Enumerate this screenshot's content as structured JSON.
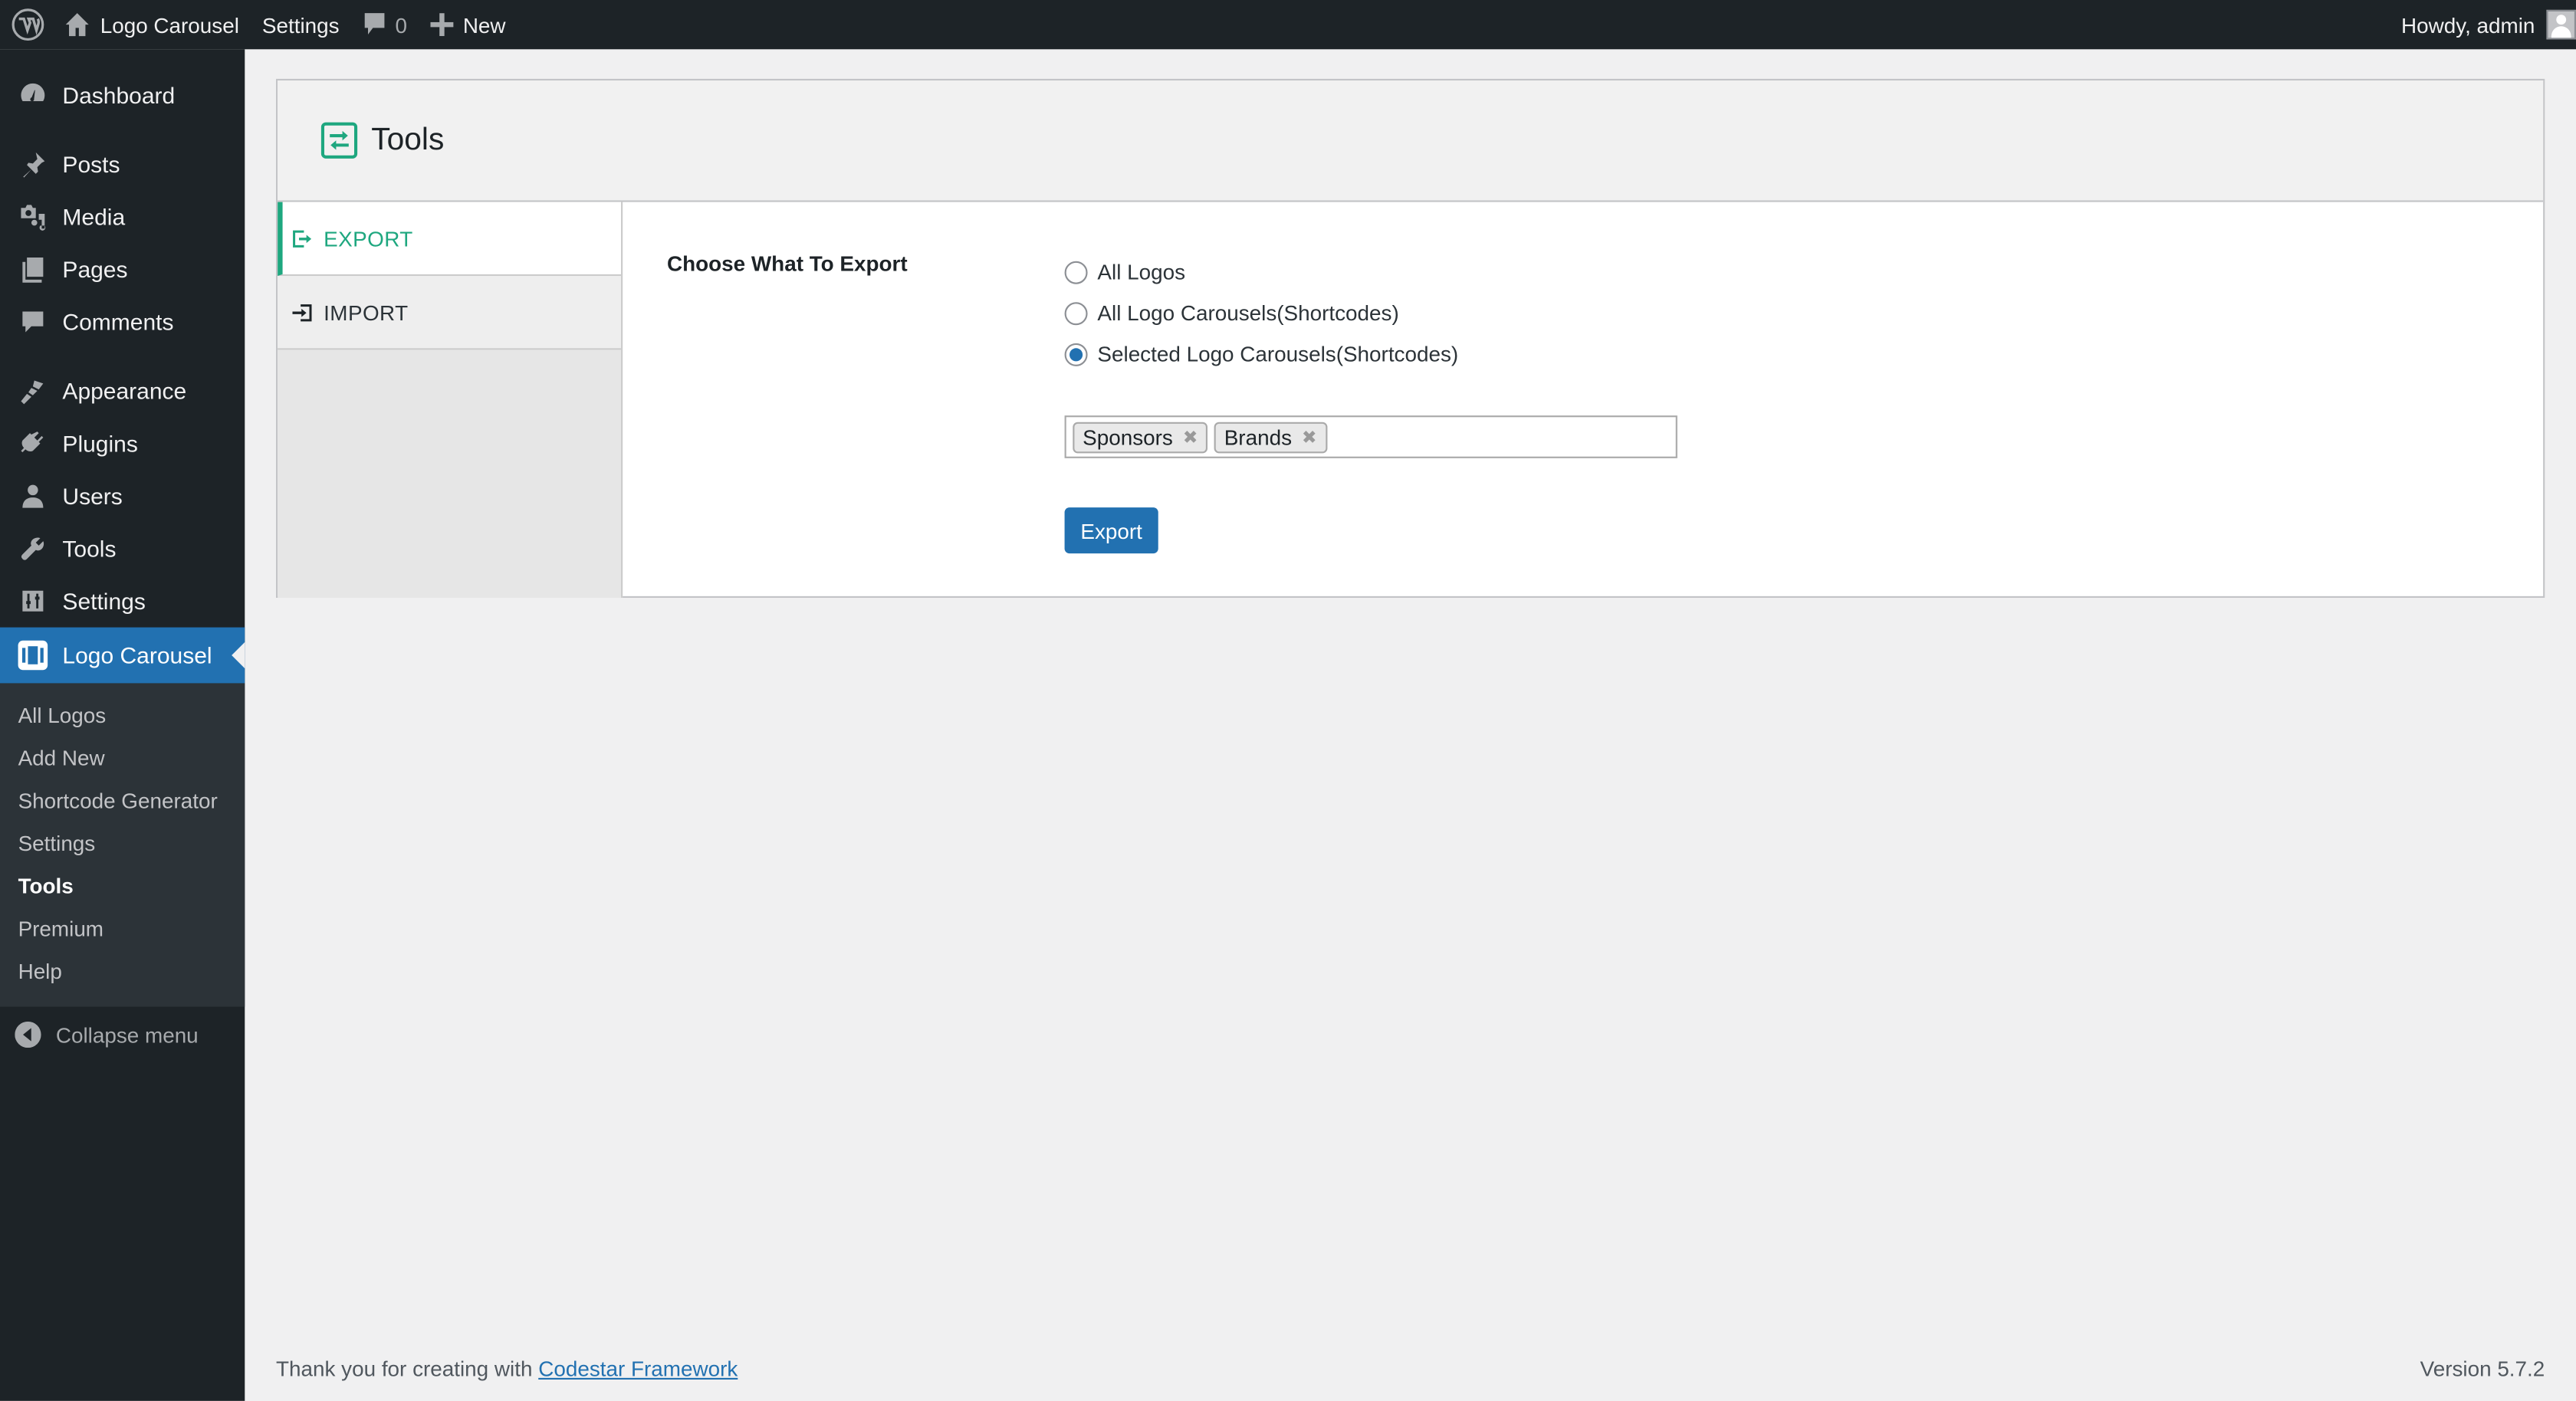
{
  "adminbar": {
    "site_name": "Logo Carousel",
    "settings_label": "Settings",
    "comments_count": "0",
    "new_label": "New",
    "greeting": "Howdy, admin"
  },
  "sidebar": {
    "items": [
      {
        "label": "Dashboard",
        "icon": "dashboard-icon"
      },
      {
        "label": "Posts",
        "icon": "pin-icon"
      },
      {
        "label": "Media",
        "icon": "media-icon"
      },
      {
        "label": "Pages",
        "icon": "pages-icon"
      },
      {
        "label": "Comments",
        "icon": "comment-icon"
      },
      {
        "label": "Appearance",
        "icon": "brush-icon"
      },
      {
        "label": "Plugins",
        "icon": "plugin-icon"
      },
      {
        "label": "Users",
        "icon": "user-icon"
      },
      {
        "label": "Tools",
        "icon": "wrench-icon"
      },
      {
        "label": "Settings",
        "icon": "sliders-icon"
      },
      {
        "label": "Logo Carousel",
        "icon": "carousel-icon",
        "current": true
      }
    ],
    "submenu": [
      {
        "label": "All Logos"
      },
      {
        "label": "Add New"
      },
      {
        "label": "Shortcode Generator"
      },
      {
        "label": "Settings"
      },
      {
        "label": "Tools",
        "current": true
      },
      {
        "label": "Premium"
      },
      {
        "label": "Help"
      }
    ],
    "collapse_label": "Collapse menu"
  },
  "page": {
    "title": "Tools",
    "accent_color": "#1ea77f",
    "tabs": [
      {
        "label": "EXPORT",
        "active": true
      },
      {
        "label": "IMPORT",
        "active": false
      }
    ],
    "export": {
      "field_title": "Choose What To Export",
      "options": [
        {
          "label": "All Logos",
          "checked": false
        },
        {
          "label": "All Logo Carousels(Shortcodes)",
          "checked": false
        },
        {
          "label": "Selected Logo Carousels(Shortcodes)",
          "checked": true
        }
      ],
      "selected_tags": [
        "Sponsors",
        "Brands"
      ],
      "button_label": "Export",
      "button_color": "#2271b1"
    }
  },
  "footer": {
    "thanks_text": "Thank you for creating with",
    "link_text": "Codestar Framework",
    "version": "Version 5.7.2"
  }
}
